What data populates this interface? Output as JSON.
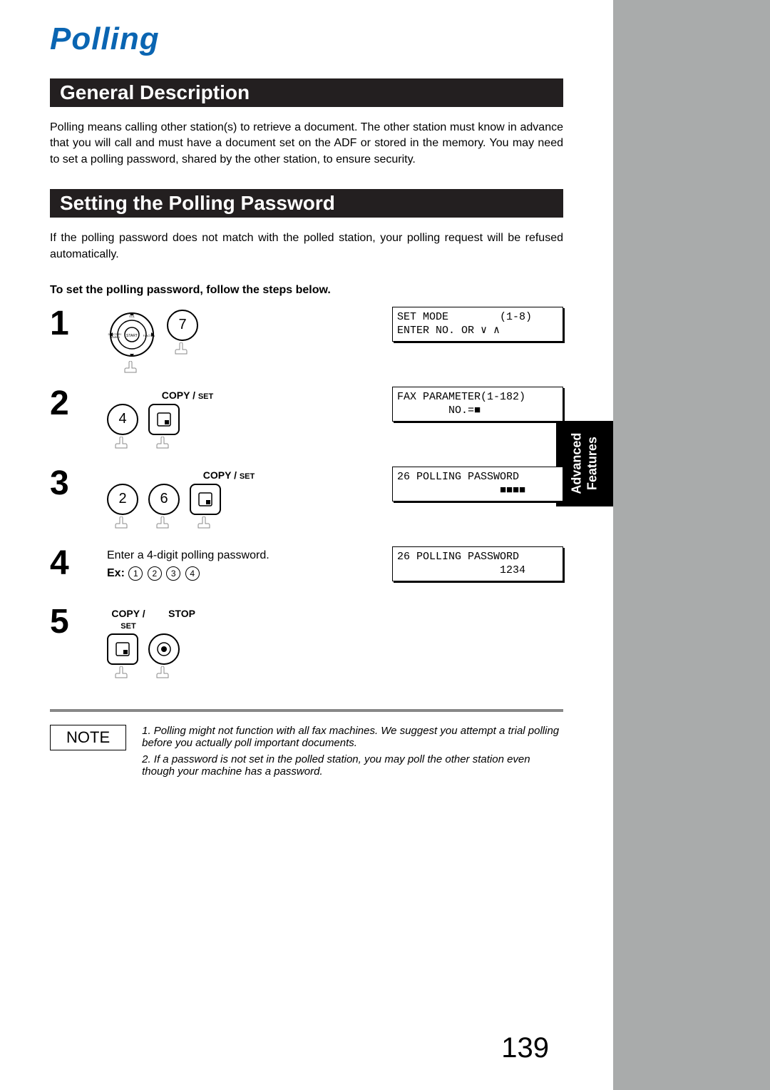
{
  "title": "Polling",
  "sections": {
    "general": {
      "heading": "General Description",
      "body": "Polling means calling other station(s) to retrieve a document.  The other station must know in advance that you will call and must have a document set on the ADF or stored in the memory.  You may need to set a polling password, shared by the other station, to ensure security."
    },
    "setting": {
      "heading": "Setting the Polling Password",
      "intro": "If the polling password does not match with the polled station, your polling request will be refused automatically.",
      "instruction": "To set the polling password, follow the steps below."
    }
  },
  "labels": {
    "copyset": "COPY /",
    "copyset_small": "SET",
    "stop": "STOP",
    "ex": "Ex:"
  },
  "steps": [
    {
      "num": "1",
      "lcd": "SET MODE        (1-8)\nENTER NO. OR ∨ ∧",
      "keys": [
        "dial",
        "7"
      ]
    },
    {
      "num": "2",
      "label": true,
      "lcd": "FAX PARAMETER(1-182)\n        NO.=■",
      "keys": [
        "4",
        "rect"
      ]
    },
    {
      "num": "3",
      "label": true,
      "lcd": "26 POLLING PASSWORD\n                ■■■■",
      "keys": [
        "2",
        "6",
        "rect"
      ]
    },
    {
      "num": "4",
      "text": "Enter a 4-digit polling password.",
      "ex_digits": [
        "1",
        "2",
        "3",
        "4"
      ],
      "lcd": "26 POLLING PASSWORD\n                1234"
    },
    {
      "num": "5",
      "double_label": true,
      "keys": [
        "rect",
        "stop"
      ]
    }
  ],
  "note": {
    "label": "NOTE",
    "items": [
      "1. Polling might not function with all fax machines.  We suggest you attempt a trial polling before you actually poll important documents.",
      "2. If a password is not set in the polled station, you may poll the other station even though your machine has a password."
    ]
  },
  "sidebar_tab": "Advanced\nFeatures",
  "page_number": "139"
}
